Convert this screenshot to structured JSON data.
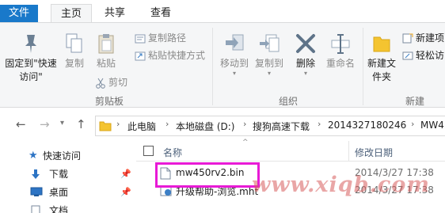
{
  "tabs": {
    "file": "文件",
    "home": "主页",
    "share": "共享",
    "view": "查看"
  },
  "ribbon": {
    "clipboard": {
      "pin_quick_access": "固定到\"快速访问\"",
      "copy": "复制",
      "paste": "粘贴",
      "copy_path": "复制路径",
      "paste_shortcut": "粘贴快捷方式",
      "cut": "剪切",
      "group_label": "剪贴板"
    },
    "organize": {
      "move_to": "移动到",
      "copy_to": "复制到",
      "delete": "删除",
      "rename": "重命名",
      "group_label": "组织"
    },
    "new": {
      "new_folder": "新建文件夹",
      "new_item": "新建项",
      "easy_access": "轻松访",
      "group_label": "新建"
    }
  },
  "address_bar": {
    "crumbs": [
      "此电脑",
      "本地磁盘 (D:)",
      "搜狗高速下载",
      "2014327180246",
      "MW4"
    ]
  },
  "nav_pane": {
    "items": [
      {
        "label": "快速访问",
        "icon": "star-icon"
      },
      {
        "label": "下载",
        "icon": "download-arrow-icon"
      },
      {
        "label": "桌面",
        "icon": "desktop-icon"
      },
      {
        "label": "文档",
        "icon": "document-icon"
      }
    ]
  },
  "file_list": {
    "columns": {
      "name": "名称",
      "date": "修改日期"
    },
    "rows": [
      {
        "name": "mw450rv2.bin",
        "date": "2014/3/27 17:38",
        "icon": "file-icon"
      },
      {
        "name": "升级帮助-浏览.mht",
        "date": "2014/3/27 17:38",
        "icon": "web-archive-icon"
      }
    ]
  },
  "watermark": "www.xiqb.com",
  "colors": {
    "file_tab": "#1979ca",
    "highlight_box": "#e81ad6",
    "ribbon_bg": "#f5f6f7",
    "watermark": "#d75c5c"
  }
}
